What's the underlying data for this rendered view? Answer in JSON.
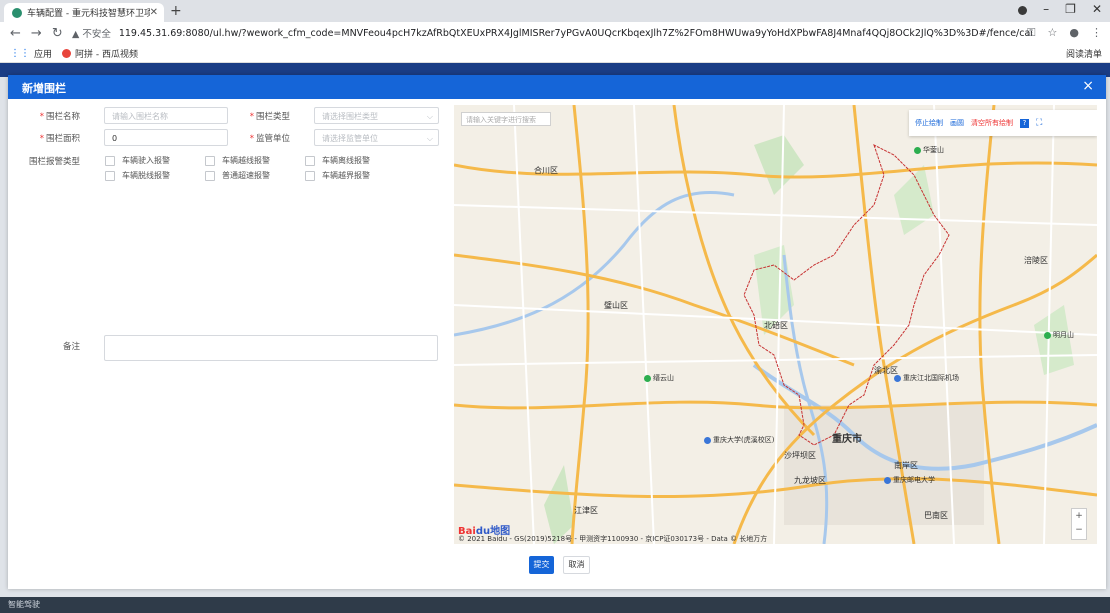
{
  "browser": {
    "tab_title": "车辆配置 - 重元科技智慧环卫项...",
    "url_warning": "▲ 不安全",
    "url": "119.45.31.69:8080/ul.hw/?wework_cfm_code=MNVFeou4pcH7kzAfRbQtXEUxPRX4JglMISRer7yPGvA0UQcrKbqexJlh7Z%2FOm8HWUwa9yYoHdXPbwFA8J4Mnaf4QQj8OCk2JlQ%3D%3D#/fence/carConfig/index/1a0ac432-9316-4b9a-b...",
    "bookmarks": [
      "应用",
      "阿拼 - 西瓜视频"
    ],
    "reading_list": "阅读清单"
  },
  "background": {
    "footer_text": "智能驾驶"
  },
  "modal": {
    "title": "新增围栏",
    "close": "×",
    "form": {
      "fence_name": {
        "label": "围栏名称",
        "placeholder": "请输入围栏名称"
      },
      "fence_type": {
        "label": "围栏类型",
        "placeholder": "请选择围栏类型"
      },
      "fence_area": {
        "label": "围栏面积",
        "value": "0"
      },
      "supervisor": {
        "label": "监管单位",
        "placeholder": "请选择监管单位"
      },
      "alarm_types": {
        "label": "围栏报警类型",
        "options": [
          "车辆驶入报警",
          "车辆越线报警",
          "车辆离线报警",
          "车辆脱线报警",
          "普通超速报警",
          "车辆越界报警"
        ]
      },
      "remark": {
        "label": "备注"
      }
    },
    "map": {
      "search_placeholder": "请输入关键字进行搜索",
      "tools": {
        "stop": "停止绘制",
        "circle": "画圆",
        "clear": "清空所有绘制"
      },
      "city": "重庆市",
      "labels": [
        "合川区",
        "北碚区",
        "璧山区",
        "江津区",
        "渝北区",
        "沙坪坝区",
        "九龙坡区",
        "南岸区",
        "涪陵区",
        "巴南区"
      ],
      "pois": [
        "缙云山",
        "重庆江北国际机场",
        "重庆大学(虎溪校区)",
        "重庆邮电大学",
        "华蓥山",
        "明月山"
      ],
      "baidu_logo": "Bai",
      "baidu_logo_suffix": "du地图",
      "copyright": "© 2021 Baidu - GS(2019)5218号 - 甲测资字1100930 - 京ICP证030173号 - Data © 长地万方"
    },
    "buttons": {
      "submit": "提交",
      "cancel": "取消"
    }
  }
}
